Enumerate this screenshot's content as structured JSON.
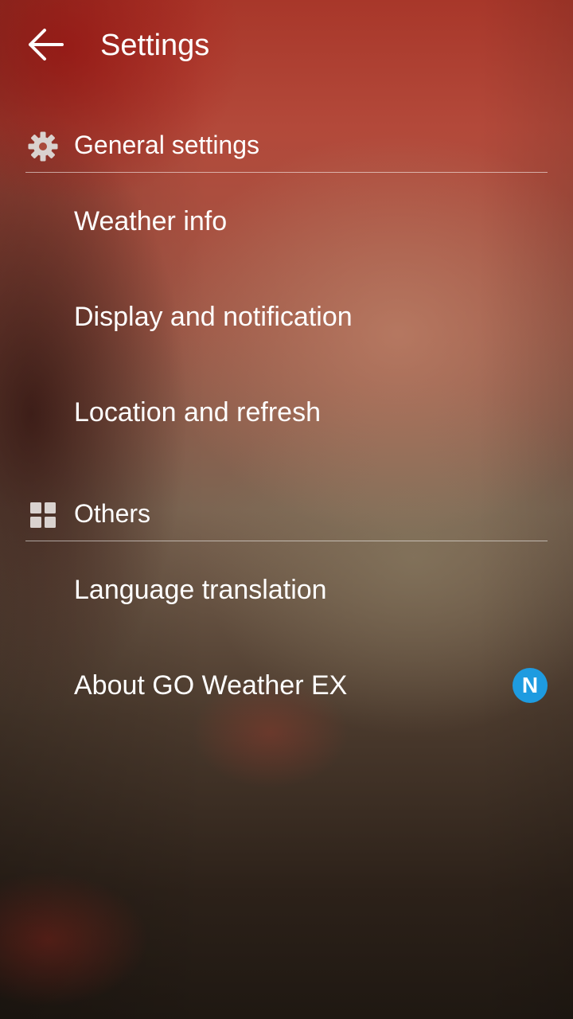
{
  "app_bar": {
    "back_icon": "arrow-left-icon",
    "title": "Settings"
  },
  "sections": [
    {
      "icon": "gear-icon",
      "title": "General settings",
      "items": [
        {
          "label": "Weather info"
        },
        {
          "label": "Display and notification"
        },
        {
          "label": "Location and refresh"
        }
      ]
    },
    {
      "icon": "grid-icon",
      "title": "Others",
      "items": [
        {
          "label": "Language translation"
        },
        {
          "label": "About GO Weather EX",
          "badge": "N"
        }
      ]
    }
  ],
  "colors": {
    "badge": "#1e9be0",
    "text": "#ffffff"
  }
}
